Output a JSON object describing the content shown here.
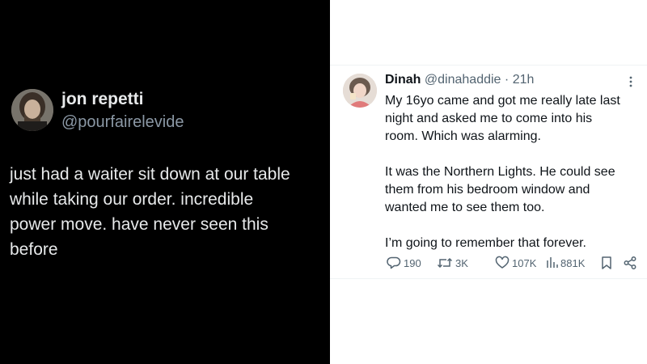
{
  "left_tweet": {
    "name": "jon repetti",
    "handle": "@pourfairelevide",
    "text_lines": [
      "just had a waiter sit down at our table",
      "while taking our order. incredible",
      "power move. have never seen this",
      "before"
    ]
  },
  "right_tweet": {
    "name": "Dinah",
    "handle": "@dinahaddie",
    "separator": "·",
    "time": "21h",
    "paragraph1": [
      "My 16yo came and got me really late last",
      "night and asked me to come into his",
      "room. Which was alarming."
    ],
    "paragraph2": [
      "It was the Northern Lights. He could see",
      "them from his bedroom window and",
      "wanted me to see them too."
    ],
    "paragraph3": [
      "I’m going to remember that forever."
    ],
    "actions": {
      "replies": "190",
      "reposts": "3K",
      "likes": "107K",
      "views": "881K"
    },
    "icons": {
      "reply": "reply-icon",
      "repost": "repost-icon",
      "like": "heart-icon",
      "views": "views-icon",
      "bookmark": "bookmark-icon",
      "share": "share-icon",
      "more": "more-icon"
    },
    "icon_color": "#536471"
  }
}
